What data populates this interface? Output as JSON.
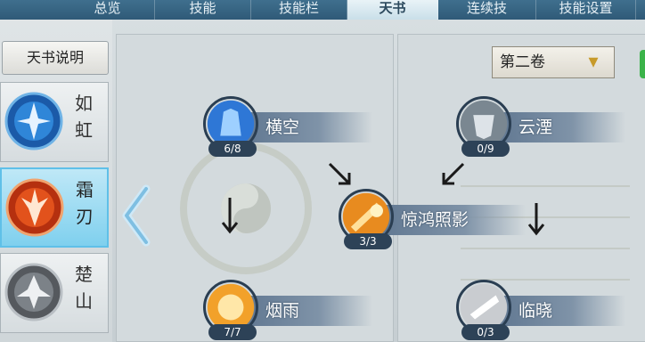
{
  "tabs": [
    {
      "label": "总览",
      "active": false
    },
    {
      "label": "技能",
      "active": false
    },
    {
      "label": "技能栏",
      "active": false
    },
    {
      "label": "天书",
      "active": true
    },
    {
      "label": "连续技",
      "active": false
    },
    {
      "label": "技能设置",
      "active": false
    }
  ],
  "sidebar": {
    "description_button": "天书说明",
    "schools": [
      {
        "name_top": "如",
        "name_bottom": "虹",
        "selected": false
      },
      {
        "name_top": "霜",
        "name_bottom": "刃",
        "selected": true
      },
      {
        "name_top": "楚",
        "name_bottom": "山",
        "selected": false
      }
    ]
  },
  "volume_select": {
    "value": "第二卷",
    "icon": "chevron-down-icon"
  },
  "skills": [
    {
      "name": "横空",
      "level": "6/8",
      "color": "#2e77d6"
    },
    {
      "name": "云湮",
      "level": "0/9",
      "color": "#8c9aa5"
    },
    {
      "name": "惊鸿照影",
      "level": "3/3",
      "color": "#e88b1f"
    },
    {
      "name": "烟雨",
      "level": "7/7",
      "color": "#f2a12a"
    },
    {
      "name": "临晓",
      "level": "0/3",
      "color": "#d8dadc"
    }
  ],
  "colors": {
    "tab_bar": "#3f6f8e",
    "active_tab": "#e9f3f7",
    "selected_school": "#7fd0ee"
  }
}
